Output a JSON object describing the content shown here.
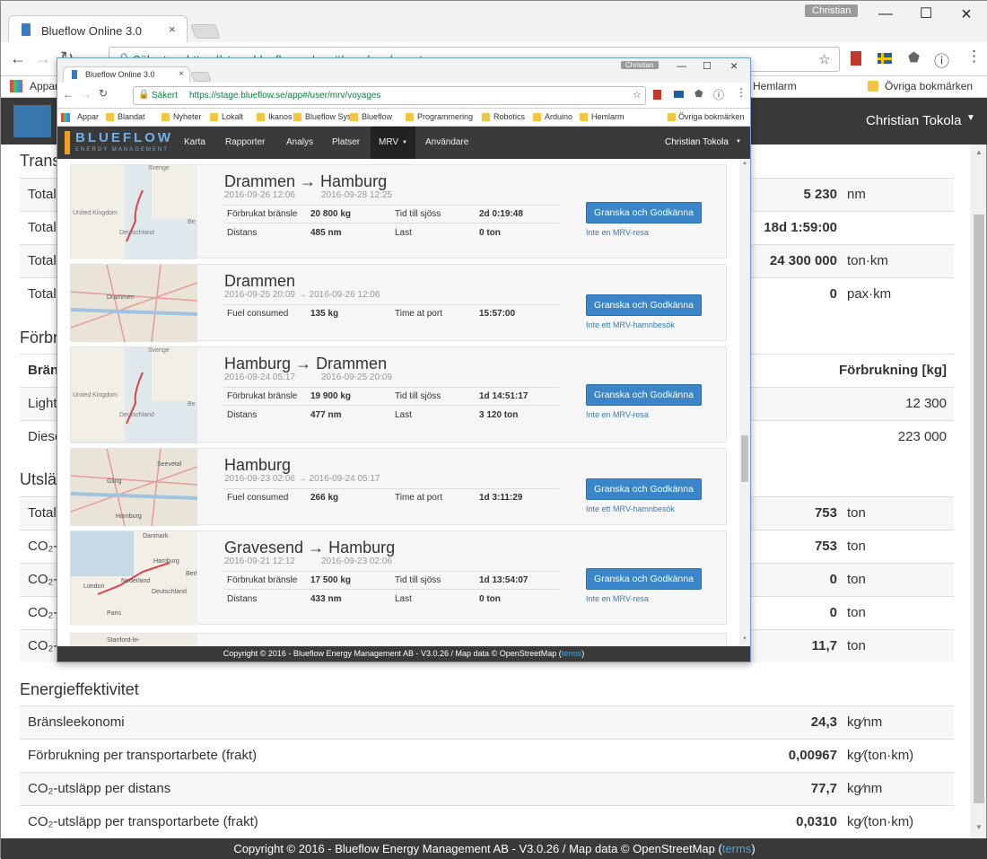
{
  "back": {
    "tab_title": "Blueflow Online 3.0",
    "user_chip": "Christian",
    "omni_secure": "Säkert",
    "omni_url": "https://stage.blueflow.se/app#/user/mrv/reports",
    "bookmarks": {
      "apps": "Appar",
      "right_visible": "Hemlarm",
      "other": "Övriga bokmärken"
    },
    "nav_user": "Christian Tokola",
    "sections": [
      {
        "heading": "Trans",
        "rows": [
          {
            "label": "Total",
            "value": "5 230",
            "unit": "nm"
          },
          {
            "label": "Total",
            "value": "18d 1:59:00",
            "unit": ""
          },
          {
            "label": "Total",
            "value": "24 300 000",
            "unit": "ton·km"
          },
          {
            "label": "Total",
            "value": "0",
            "unit": "pax·km"
          }
        ]
      },
      {
        "heading": "Förbr",
        "header_left": "Bräns",
        "header_right": "Förbrukning [kg]",
        "rows": [
          {
            "label": "Light",
            "value": "12 300"
          },
          {
            "label": "Diese",
            "value": "223 000"
          }
        ]
      },
      {
        "heading": "Utsläp",
        "rows": [
          {
            "label": "Totala",
            "value": "753",
            "unit": "ton"
          },
          {
            "label": "CO₂-u",
            "value": "753",
            "unit": "ton"
          },
          {
            "label": "CO₂-u",
            "value": "0",
            "unit": "ton"
          },
          {
            "label": "CO₂-u",
            "value": "0",
            "unit": "ton"
          },
          {
            "label": "CO₂-u",
            "value": "11,7",
            "unit": "ton"
          }
        ]
      },
      {
        "heading": "Energieffektivitet",
        "rows": [
          {
            "label": "Bränsleekonomi",
            "value": "24,3",
            "unit": "kg⁄nm"
          },
          {
            "label": "Förbrukning per transportarbete (frakt)",
            "value": "0,00967",
            "unit": "kg⁄(ton·km)"
          },
          {
            "label": "CO₂-utsläpp per distans",
            "value": "77,7",
            "unit": "kg⁄nm"
          },
          {
            "label": "CO₂-utsläpp per transportarbete (frakt)",
            "value": "0,0310",
            "unit": "kg⁄(ton·km)"
          }
        ]
      }
    ],
    "footer_text": "Copyright © 2016 - Blueflow Energy Management AB - V3.0.26 / Map data © OpenStreetMap (",
    "footer_link": "terms",
    "footer_end": ")"
  },
  "front": {
    "tab_title": "Blueflow Online 3.0",
    "user_chip": "Christian",
    "omni_secure": "Säkert",
    "omni_url": "https://stage.blueflow.se/app#/user/mrv/voyages",
    "bookmarks": [
      "Appar",
      "Blandat",
      "Nyheter",
      "Lokalt",
      "Ikanos",
      "Blueflow Sys",
      "Blueflow",
      "Programmering",
      "Robotics",
      "Arduino",
      "Hemlarm"
    ],
    "bookmarks_other": "Övriga bokmärken",
    "logo_text": "BLUEFLOW",
    "logo_sub": "ENERGY MANAGEMENT",
    "nav": [
      "Karta",
      "Rapporter",
      "Analys",
      "Platser",
      "MRV",
      "Användare"
    ],
    "nav_user": "Christian Tokola",
    "voyages": [
      {
        "from": "Drammen",
        "to": "Hamburg",
        "d1": "2016-09-26 12:06",
        "d2": "2016-09-28 12:25",
        "k1": "Förbrukat bränsle",
        "v1": "20 800 kg",
        "k2": "Tid till sjöss",
        "v2": "2d 0:19:48",
        "k3": "Distans",
        "v3": "485 nm",
        "k4": "Last",
        "v4": "0 ton",
        "button": "Granska och Godkänna",
        "link": "Inte en MRV-resa",
        "map": [
          "Sverige",
          "United Kingdom",
          "Deutschland",
          "Be"
        ]
      },
      {
        "from": "Drammen",
        "to": "",
        "d1": "2016-09-25 20:09 → 2016-09-26 12:06",
        "d2": "",
        "k1": "Fuel consumed",
        "v1": "135 kg",
        "k2": "Time at port",
        "v2": "15:57:00",
        "button": "Granska och Godkänna",
        "link": "Inte ett MRV-hamnbesök",
        "map": [
          "Drammen"
        ]
      },
      {
        "from": "Hamburg",
        "to": "Drammen",
        "d1": "2016-09-24 05:17",
        "d2": "2016-09-25 20:09",
        "k1": "Förbrukat bränsle",
        "v1": "19 900 kg",
        "k2": "Tid till sjöss",
        "v2": "1d 14:51:17",
        "k3": "Distans",
        "v3": "477 nm",
        "k4": "Last",
        "v4": "3 120 ton",
        "button": "Granska och Godkänna",
        "link": "Inte en MRV-resa",
        "map": [
          "Sverige",
          "United Kingdom",
          "Deutschland",
          "Be"
        ]
      },
      {
        "from": "Hamburg",
        "to": "",
        "d1": "2016-09-23 02:06 → 2016-09-24 05:17",
        "d2": "",
        "k1": "Fuel consumed",
        "v1": "266 kg",
        "k2": "Time at port",
        "v2": "1d 3:11:29",
        "button": "Granska och Godkänna",
        "link": "Inte ett MRV-hamnbesök",
        "map": [
          "Gling",
          "Seevetal",
          "Hamburg"
        ]
      },
      {
        "from": "Gravesend",
        "to": "Hamburg",
        "d1": "2016-09-21 12:12",
        "d2": "2016-09-23 02:06",
        "k1": "Förbrukat bränsle",
        "v1": "17 500 kg",
        "k2": "Tid till sjöss",
        "v2": "1d 13:54:07",
        "k3": "Distans",
        "v3": "433 nm",
        "k4": "Last",
        "v4": "0 ton",
        "button": "Granska och Godkänna",
        "link": "Inte en MRV-resa",
        "map": [
          "Danmark",
          "Hamburg",
          "Berl",
          "London",
          "Nederland",
          "Deutschland",
          "Paris"
        ]
      }
    ],
    "partial_card_label": "Stanford-le-",
    "footer_text": "Copyright © 2016 - Blueflow Energy Management AB - V3.0.26 / Map data © OpenStreetMap (",
    "footer_link": "terms",
    "footer_end": ")"
  },
  "colors": {
    "navbar": "#3a3a3a",
    "button": "#3a86c8",
    "link": "#3a7cc0",
    "route": "#e04040"
  }
}
